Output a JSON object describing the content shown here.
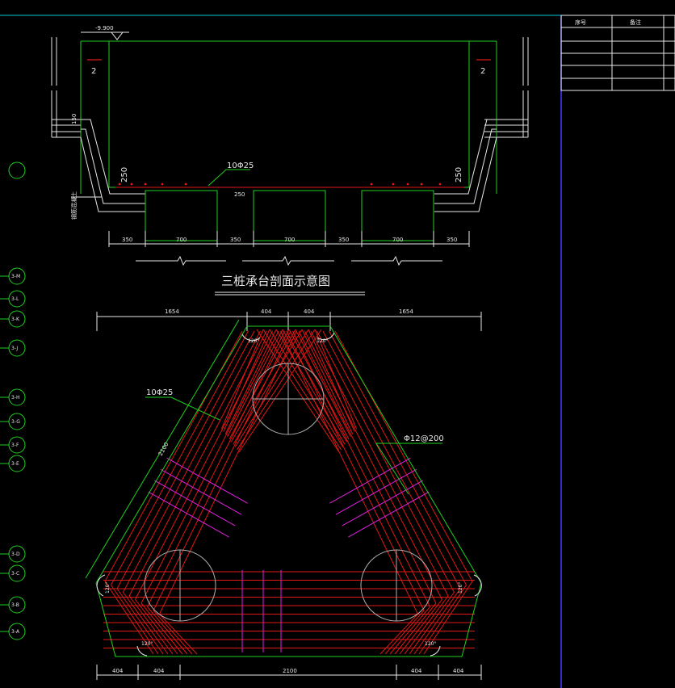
{
  "drawing": {
    "elevation": "-9.900",
    "section_mark": "2",
    "cover_left": "250",
    "cover_right": "250",
    "top_bar_label": "10Φ25",
    "bottom_dims": [
      "350",
      "700",
      "350",
      "700",
      "350",
      "700",
      "350"
    ],
    "small_dim": "150",
    "small_dim2": "250",
    "side_note": "钢筋混凝土",
    "section_title": "三桩承台剖面示意图",
    "plan_top_dims": [
      "1654",
      "404",
      "404",
      "1654"
    ],
    "plan_bottom_dims": [
      "404",
      "404",
      "2100",
      "404",
      "404"
    ],
    "plan_side_dim": "2100",
    "plan_bar_label": "10Φ25",
    "stirrup_label": "Φ12@200",
    "angle_label": "120°",
    "axis_bubbles": [
      "3-M",
      "3-L",
      "3-K",
      "3-J",
      "3-H",
      "3-G",
      "3-F",
      "3-E",
      "3-D",
      "3-C",
      "3-B",
      "3-A"
    ],
    "table_headers": [
      "序号",
      "备注"
    ]
  },
  "colors": {
    "background": "#000000",
    "outline": "#20d020",
    "rebar": "#e01818",
    "stirrup": "#e020e0",
    "text": "#e8e8e8",
    "frame": "#4040ff",
    "top_border": "#00c8d0"
  }
}
